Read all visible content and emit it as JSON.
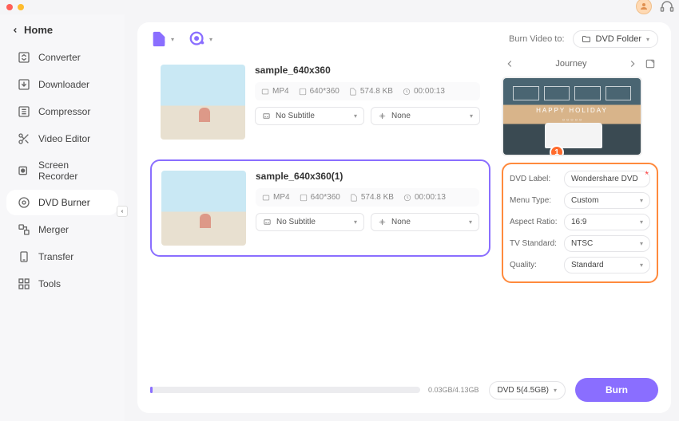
{
  "window": {
    "home_label": "Home"
  },
  "sidebar": {
    "items": [
      {
        "label": "Converter"
      },
      {
        "label": "Downloader"
      },
      {
        "label": "Compressor"
      },
      {
        "label": "Video Editor"
      },
      {
        "label": "Screen Recorder"
      },
      {
        "label": "DVD Burner"
      },
      {
        "label": "Merger"
      },
      {
        "label": "Transfer"
      },
      {
        "label": "Tools"
      }
    ],
    "active_index": 5
  },
  "topbar": {
    "burn_to_label": "Burn Video to:",
    "burn_to_value": "DVD Folder"
  },
  "files": [
    {
      "name": "sample_640x360",
      "format": "MP4",
      "resolution": "640*360",
      "size": "574.8 KB",
      "duration": "00:00:13",
      "subtitle": "No Subtitle",
      "audio": "None",
      "selected": false
    },
    {
      "name": "sample_640x360(1)",
      "format": "MP4",
      "resolution": "640*360",
      "size": "574.8 KB",
      "duration": "00:00:13",
      "subtitle": "No Subtitle",
      "audio": "None",
      "selected": true
    }
  ],
  "template": {
    "name": "Journey",
    "preview_text": "HAPPY HOLIDAY",
    "callout": "1"
  },
  "settings": {
    "dvd_label_label": "DVD Label:",
    "dvd_label_value": "Wondershare DVD",
    "menu_type_label": "Menu Type:",
    "menu_type_value": "Custom",
    "aspect_ratio_label": "Aspect Ratio:",
    "aspect_ratio_value": "16:9",
    "tv_standard_label": "TV Standard:",
    "tv_standard_value": "NTSC",
    "quality_label": "Quality:",
    "quality_value": "Standard"
  },
  "bottom": {
    "progress_text": "0.03GB/4.13GB",
    "disc_value": "DVD 5(4.5GB)",
    "burn_label": "Burn"
  }
}
